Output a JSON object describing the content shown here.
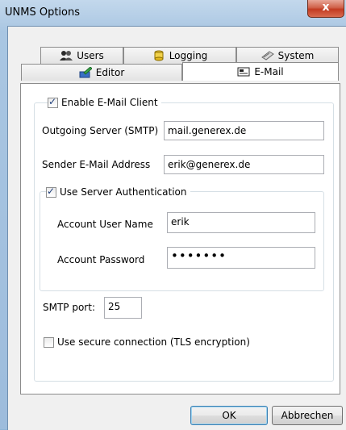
{
  "window": {
    "title": "UNMS Options",
    "close_glyph": "x"
  },
  "tabs": {
    "row_back": [
      {
        "label": "Users",
        "icon": "users-icon"
      },
      {
        "label": "Logging",
        "icon": "database-icon"
      },
      {
        "label": "System",
        "icon": "modem-icon"
      }
    ],
    "row_front": [
      {
        "label": "Editor",
        "icon": "editor-icon"
      },
      {
        "label": "E-Mail",
        "icon": "email-icon",
        "selected": true
      }
    ]
  },
  "email": {
    "enable_client": {
      "label": "Enable E-Mail Client",
      "checked": true
    },
    "outgoing_server": {
      "label": "Outgoing Server (SMTP)",
      "value": "mail.generex.de"
    },
    "sender_address": {
      "label": "Sender E-Mail Address",
      "value": "erik@generex.de"
    },
    "use_auth": {
      "label": "Use Server Authentication",
      "checked": true
    },
    "account_user": {
      "label": "Account User Name",
      "value": "erik"
    },
    "account_password": {
      "label": "Account Password",
      "value": "•••••••"
    },
    "smtp_port": {
      "label": "SMTP port:",
      "value": "25"
    },
    "secure_connection": {
      "label": "Use secure connection (TLS encryption)",
      "checked": false
    }
  },
  "buttons": {
    "ok": "OK",
    "cancel": "Abbrechen"
  }
}
